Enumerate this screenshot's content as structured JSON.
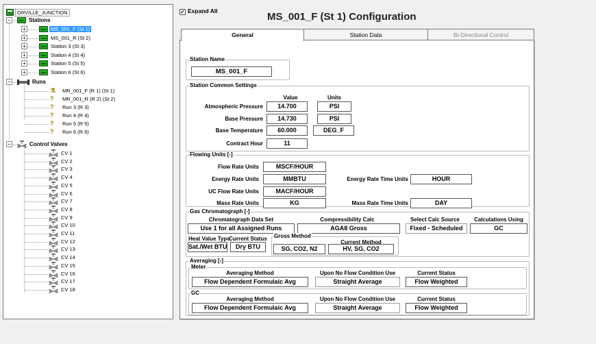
{
  "tree": {
    "root": "ORVILLE_JUNCTION",
    "stations_label": "Stations",
    "stations": [
      "MS_001_F (St 1)",
      "MS_001_R (St 2)",
      "Station 3 (St 3)",
      "Station 4 (St 4)",
      "Station 5 (St 5)",
      "Station 6 (St 6)"
    ],
    "runs_label": "Runs",
    "runs": [
      "MR_001_F (R 1) (St 1)",
      "MR_001_R (R 2) (St 2)",
      "Run 3 (R 3)",
      "Run 4 (R 4)",
      "Run 5 (R 5)",
      "Run 6 (R 6)"
    ],
    "valves_label": "Control Valves",
    "valves": [
      "CV 1",
      "CV 2",
      "CV 3",
      "CV 4",
      "CV 5",
      "CV 6",
      "CV 7",
      "CV 8",
      "CV 9",
      "CV 10",
      "CV 11",
      "CV 12",
      "CV 13",
      "CV 14",
      "CV 15",
      "CV 16",
      "CV 17",
      "CV 18"
    ]
  },
  "expand_all": "Expand All",
  "title": "MS_001_F (St 1) Configuration",
  "tabs": [
    "General",
    "Station Data",
    "Bi-Directional Control"
  ],
  "station_name": {
    "label": "Station Name",
    "value": "MS_001_F"
  },
  "common": {
    "label": "Station Common Settings",
    "col_value": "Value",
    "col_units": "Units",
    "atm_label": "Atmospheric Pressure",
    "atm_value": "14.700",
    "atm_units": "PSI",
    "base_p_label": "Base Pressure",
    "base_p_value": "14.730",
    "base_p_units": "PSI",
    "base_t_label": "Base Temperature",
    "base_t_value": "60.000",
    "base_t_units": "DEG_F",
    "contract_label": "Contract Hour",
    "contract_value": "11"
  },
  "flowing": {
    "label": "Flowing Units [-]",
    "flow_rate_label": "Flow Rate Units",
    "flow_rate_value": "MSCF/HOUR",
    "energy_rate_label": "Energy Rate Units",
    "energy_rate_value": "MMBTU",
    "energy_time_label": "Energy Rate Time Units",
    "energy_time_value": "HOUR",
    "uc_flow_label": "UC Flow Rate Units",
    "uc_flow_value": "MACF/HOUR",
    "mass_rate_label": "Mass Rate Units",
    "mass_rate_value": "KG",
    "mass_time_label": "Mass Rate Time Units",
    "mass_time_value": "DAY"
  },
  "gc": {
    "label": "Gas Chromatograph [-]",
    "data_set_label": "Chromatograph Data Set",
    "data_set_value": "Use 1 for all Assigned Runs",
    "compress_label": "Compressibility Calc",
    "compress_value": "AGA8 Gross",
    "calc_src_label": "Select Calc Source",
    "calc_src_value": "Fixed - Scheduled",
    "calc_using_label": "Calculations Using",
    "calc_using_value": "GC",
    "hv_type_label": "Heat Value Type",
    "hv_type_value": "Sat./Wet BTU",
    "cur_status_label": "Current Status",
    "cur_status_value": "Dry BTU",
    "gross_label": "Gross Method",
    "gross_value": "SG, CO2, N2",
    "cur_method_label": "Current Method",
    "cur_method_value": "HV, SG, CO2"
  },
  "averaging": {
    "label": "Averaging [-]",
    "meter": {
      "label": "Meter",
      "method_label": "Averaging Method",
      "method_value": "Flow Dependent Formulaic Avg",
      "noflow_label": "Upon No Flow Condition Use",
      "noflow_value": "Straight Average",
      "status_label": "Current Status",
      "status_value": "Flow Weighted"
    },
    "gc": {
      "label": "GC",
      "method_label": "Averaging Method",
      "method_value": "Flow Dependent Formulaic Avg",
      "noflow_label": "Upon No Flow Condition Use",
      "noflow_value": "Straight Average",
      "status_label": "Current Status",
      "status_value": "Flow Weighted"
    }
  },
  "colors": {
    "selection": "#3399ff",
    "station_icon": "#27a827"
  }
}
